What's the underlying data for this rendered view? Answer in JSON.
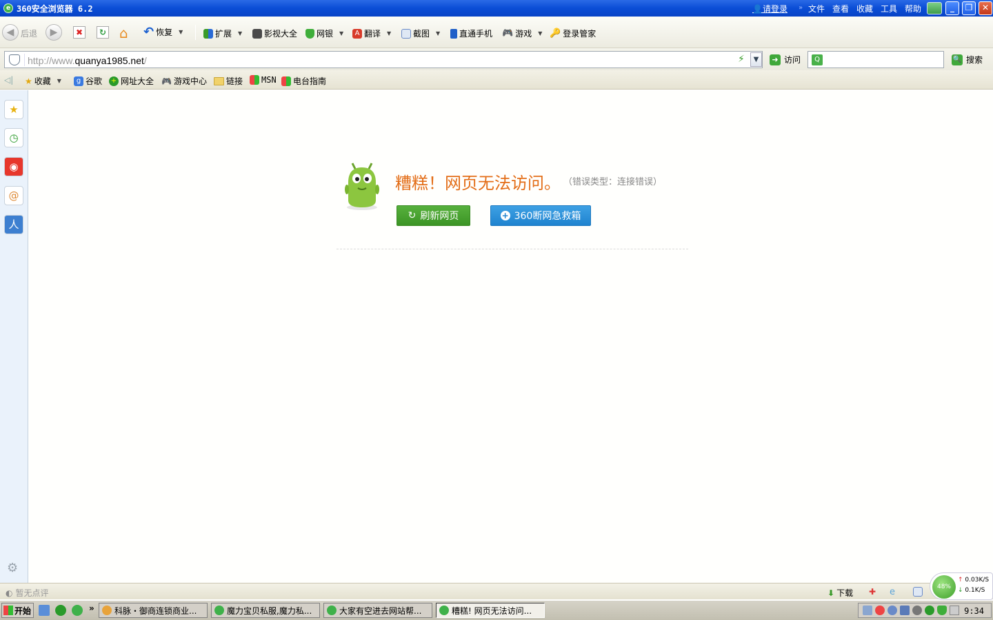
{
  "window": {
    "title": "360安全浏览器 6.2",
    "login": "请登录",
    "menu": [
      "文件",
      "查看",
      "收藏",
      "工具",
      "帮助"
    ]
  },
  "toolbar": {
    "back": "后退",
    "restore": "恢复",
    "extend": "扩展",
    "video": "影视大全",
    "bank": "网银",
    "translate": "翻译",
    "screenshot": "截图",
    "phone": "直通手机",
    "games": "游戏",
    "login_manager": "登录管家"
  },
  "address": {
    "url_prefix": "http://www.",
    "url_host": "quanya1985.net",
    "url_suffix": "/",
    "visit": "访问",
    "search": "搜索"
  },
  "favorites": {
    "collect": "收藏",
    "items": [
      "谷歌",
      "网址大全",
      "游戏中心",
      "链接",
      "MSN",
      "电台指南"
    ]
  },
  "error": {
    "title": "糟糕！网页无法访问。",
    "type": "（错误类型：连接错误）",
    "refresh": "刷新网页",
    "rescue": "360断网急救箱"
  },
  "status": {
    "comment": "暂无点评",
    "download": "下载",
    "percent": "48%",
    "up": "0.03K/S",
    "down": "0.1K/S"
  },
  "taskbar": {
    "start": "开始",
    "tasks": [
      "科脉・御商连锁商业...",
      "魔力宝贝私服,魔力私...",
      "大家有空进去网站帮...",
      "糟糕! 网页无法访问..."
    ],
    "clock": "9:34"
  },
  "colors": {
    "error_orange": "#e36d17",
    "refresh_green": "#3c9425",
    "rescue_blue": "#1f83cf",
    "titlebar_blue": "#0a4dd6"
  }
}
